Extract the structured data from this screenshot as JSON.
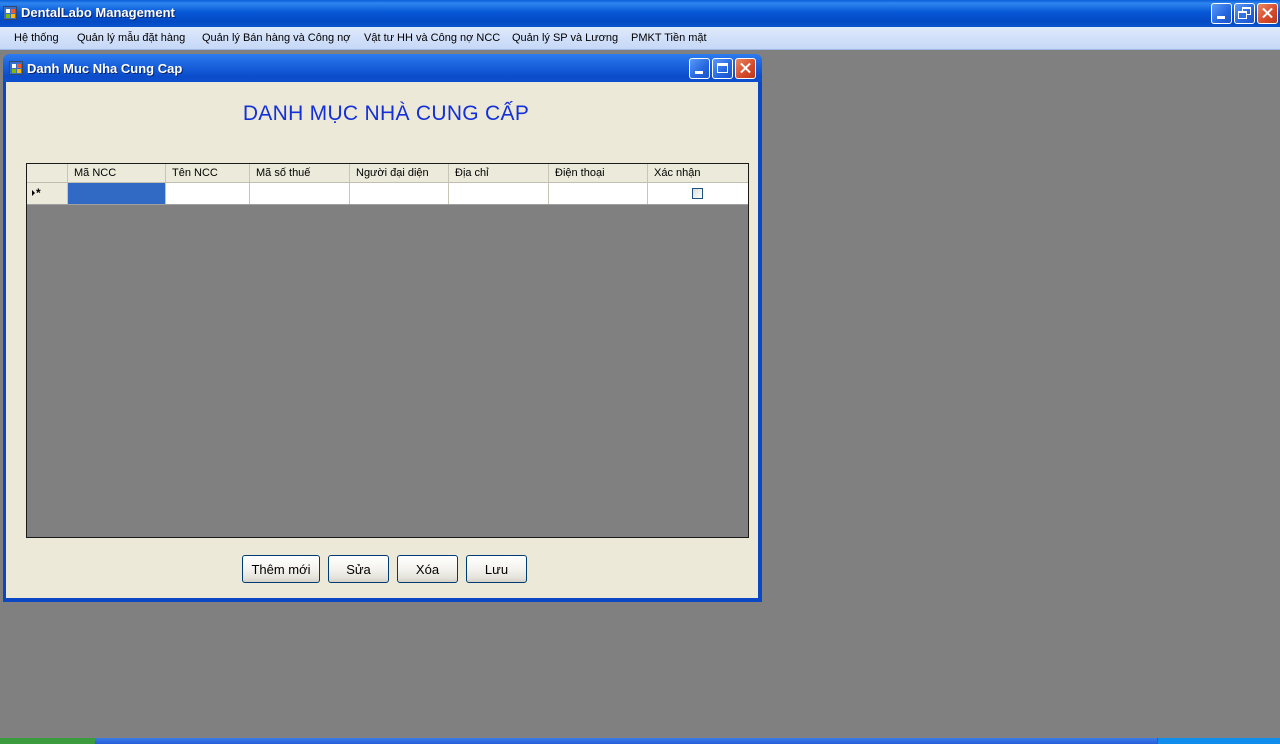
{
  "app": {
    "title": "DentalLabo Management",
    "icon": "app-icon"
  },
  "menubar": {
    "items": [
      {
        "label": "Hệ thống"
      },
      {
        "label": "Quản lý mẫu đặt hàng"
      },
      {
        "label": "Quản lý Bán hàng và Công nợ"
      },
      {
        "label": "Vật tư HH và Công nợ NCC"
      },
      {
        "label": "Quản lý SP và Lương"
      },
      {
        "label": "PMKT Tiền mặt"
      }
    ]
  },
  "child_window": {
    "title": "Danh Muc Nha Cung Cap",
    "heading": "DANH MỤC NHÀ CUNG CẤP"
  },
  "grid": {
    "columns": [
      "Mã NCC",
      "Tên NCC",
      "Mã số thuế",
      "Người đại diện",
      "Địa chỉ",
      "Điện thoại",
      "Xác nhận"
    ],
    "row_header_glyph": "*",
    "rows": [
      {
        "new_row": true,
        "values": [
          "",
          "",
          "",
          "",
          "",
          "",
          ""
        ],
        "confirmed": false,
        "selected_column": 0
      }
    ]
  },
  "buttons": {
    "add": "Thêm mới",
    "edit": "Sửa",
    "delete": "Xóa",
    "save": "Lưu"
  },
  "colors": {
    "titlebar": "#0758d6",
    "heading": "#1430d9",
    "selection": "#316ac5",
    "workspace": "#808080"
  }
}
